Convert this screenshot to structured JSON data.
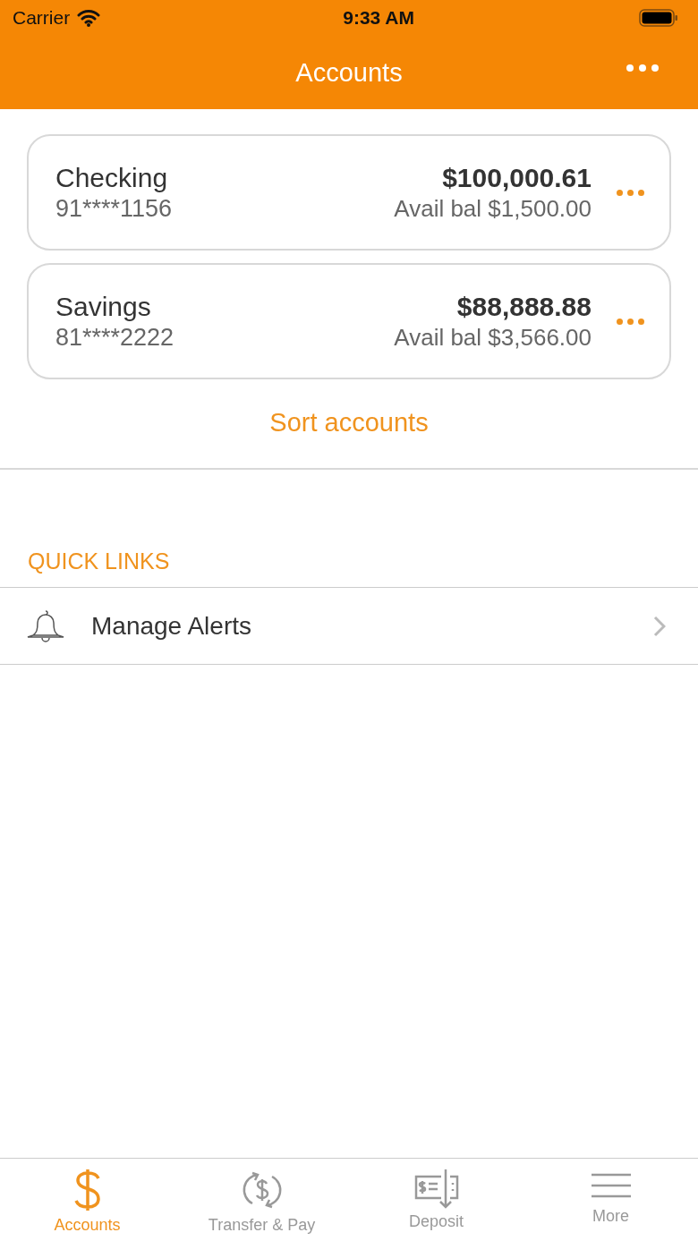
{
  "status_bar": {
    "carrier": "Carrier",
    "time": "9:33 AM"
  },
  "nav": {
    "title": "Accounts"
  },
  "accounts": [
    {
      "name": "Checking",
      "number": "91****1156",
      "balance": "$100,000.61",
      "available": "Avail bal $1,500.00"
    },
    {
      "name": "Savings",
      "number": "81****2222",
      "balance": "$88,888.88",
      "available": "Avail bal $3,566.00"
    }
  ],
  "sort_link": "Sort accounts",
  "quick_links": {
    "heading": "QUICK LINKS",
    "items": [
      {
        "label": "Manage Alerts"
      }
    ]
  },
  "tabs": [
    {
      "kind": "dollar",
      "label": "Accounts",
      "selected": true
    },
    {
      "kind": "transfer",
      "label": "Transfer & Pay",
      "selected": false
    },
    {
      "kind": "deposit",
      "label": "Deposit",
      "selected": false
    },
    {
      "kind": "menu",
      "label": "More",
      "selected": false
    }
  ]
}
